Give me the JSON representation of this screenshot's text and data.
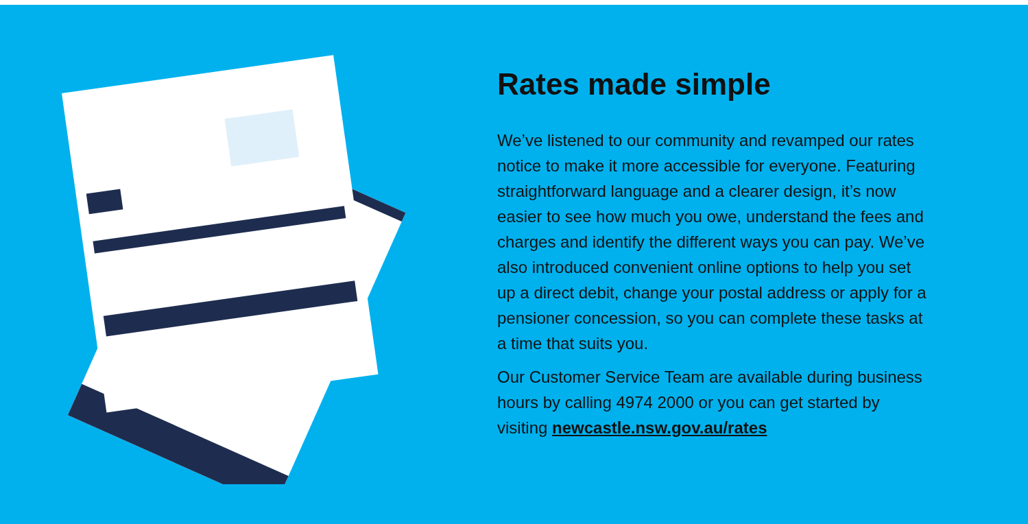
{
  "heading": "Rates made simple",
  "paragraphs": [
    {
      "text": "We’ve listened to our community and revamped our rates notice to make it more accessible for everyone. Featuring straightforward language and a clearer design, it’s now easier to see how much you owe, understand the fees and charges and identify the different ways you can pay. We’ve also introduced convenient online options to help you set up a direct debit, change your postal address or apply for a pensioner concession, so you can complete these tasks at a time that suits you."
    },
    {
      "text": "Our Customer Service Team are available during business hours by calling 4974 2000 or you can get started by visiting",
      "link": "newcastle.nsw.gov.au/rates"
    }
  ]
}
